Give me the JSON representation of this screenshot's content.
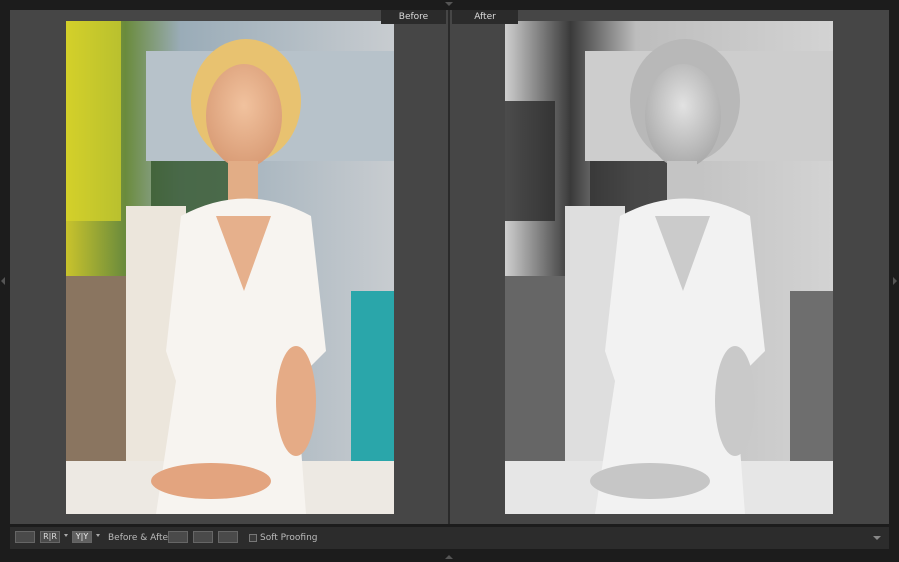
{
  "compare": {
    "before_label": "Before",
    "after_label": "After"
  },
  "toolbar": {
    "rr_label": "R|R",
    "yy_label": "Y|Y",
    "before_after_label": "Before & After :",
    "soft_proofing_label": "Soft Proofing"
  },
  "colors": {
    "background": "#1c1c1c",
    "panel": "#464646",
    "toolbar": "#2c2c2c",
    "label_tab": "#2b2b2b"
  }
}
